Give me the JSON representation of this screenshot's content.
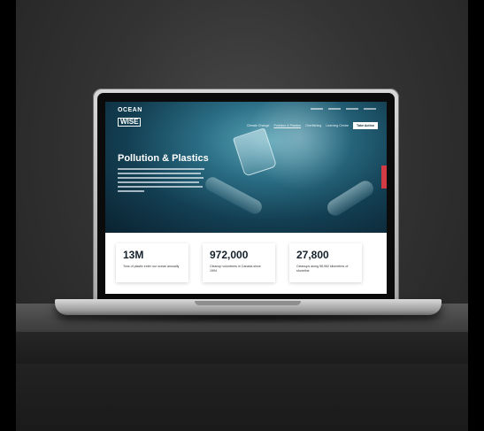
{
  "site": {
    "logo_line1": "OCEAN",
    "logo_line2": "WISE"
  },
  "nav": {
    "items": [
      "Climate Change",
      "Pollution & Plastics",
      "Overfishing",
      "Learning Centre"
    ],
    "active_index": 1,
    "cta_label": "Take Action"
  },
  "hero": {
    "title": "Pollution & Plastics"
  },
  "stats": [
    {
      "value": "13M",
      "description": "Tons of plastic enter our ocean annually"
    },
    {
      "value": "972,000",
      "description": "Cleanup volunteers in Canada since 1994"
    },
    {
      "value": "27,800",
      "description": "Cleanups along 58,962 kilometres of shoreline"
    }
  ],
  "colors": {
    "accent_red": "#d23a44",
    "ocean_dark": "#0a2230",
    "ocean_light": "#5aa4b6"
  }
}
